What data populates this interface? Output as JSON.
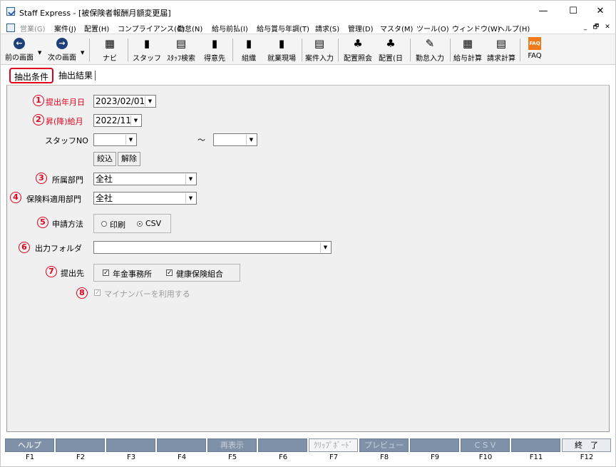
{
  "window": {
    "title": "Staff Express - [被保険者報酬月額変更届]",
    "min_glyph": "—",
    "max_glyph": "☐",
    "close_glyph": "✕"
  },
  "menu": [
    {
      "label": "営業(G)",
      "disabled": true
    },
    {
      "label": "案件(J)",
      "disabled": false
    },
    {
      "label": "配置(H)",
      "disabled": false
    },
    {
      "label": "コンプライアンス(C)",
      "disabled": false
    },
    {
      "label": "勤怠(N)",
      "disabled": false
    },
    {
      "label": "給与前払(I)",
      "disabled": false
    },
    {
      "label": "給与賞与年調(T)",
      "disabled": false
    },
    {
      "label": "請求(S)",
      "disabled": false
    },
    {
      "label": "管理(D)",
      "disabled": false
    },
    {
      "label": "マスタ(M)",
      "disabled": false
    },
    {
      "label": "ツール(O)",
      "disabled": false
    },
    {
      "label": "ウィンドウ(W)",
      "disabled": false
    },
    {
      "label": "ヘルプ(H)",
      "disabled": false
    }
  ],
  "mdi_controls": [
    "_",
    "🗗",
    "✕"
  ],
  "toolbar": [
    {
      "label": "前の画面",
      "icon": "back-arrow-icon",
      "glyph": "←"
    },
    {
      "label": "次の画面",
      "icon": "forward-arrow-icon",
      "glyph": "→"
    },
    {
      "label": "ナビ",
      "icon": "navi-icon",
      "glyph": "▦"
    },
    {
      "label": "スタッフ",
      "icon": "staff-icon",
      "glyph": "▮"
    },
    {
      "label": "ｽﾀｯﾌ検索",
      "icon": "staff-search-icon",
      "glyph": "▤"
    },
    {
      "label": "得意先",
      "icon": "client-icon",
      "glyph": "▮"
    },
    {
      "label": "組織",
      "icon": "organization-icon",
      "glyph": "▮"
    },
    {
      "label": "就業現場",
      "icon": "worksite-icon",
      "glyph": "▮"
    },
    {
      "label": "案件入力",
      "icon": "case-input-icon",
      "glyph": "▤"
    },
    {
      "label": "配置照会",
      "icon": "assignment-inquiry-icon",
      "glyph": "♣"
    },
    {
      "label": "配置(日",
      "icon": "assignment-daily-icon",
      "glyph": "♣"
    },
    {
      "label": "勤怠入力",
      "icon": "attendance-input-icon",
      "glyph": "✎"
    },
    {
      "label": "給与計算",
      "icon": "payroll-calc-icon",
      "glyph": "▦"
    },
    {
      "label": "請求計算",
      "icon": "billing-calc-icon",
      "glyph": "▤"
    },
    {
      "label": "FAQ",
      "icon": "faq-icon",
      "glyph": "FAQ"
    }
  ],
  "tabs": [
    {
      "label": "抽出条件",
      "active": true
    },
    {
      "label": "抽出結果",
      "active": false
    }
  ],
  "form": {
    "submit_date": {
      "num": "1",
      "label": "提出年月日",
      "value": "2023/02/01"
    },
    "pay_raise_month": {
      "num": "2",
      "label": "昇(降)給月",
      "value": "2022/11"
    },
    "staff_no": {
      "label": "スタッフNO",
      "from": "",
      "to": "",
      "tilde": "～"
    },
    "filter_button": "絞込",
    "clear_button": "解除",
    "department": {
      "num": "3",
      "label": "所属部門",
      "value": "全社"
    },
    "insurance_department": {
      "num": "4",
      "label": "保険料適用部門",
      "value": "全社"
    },
    "method": {
      "num": "5",
      "label": "申請方法",
      "options": [
        "印刷",
        "CSV"
      ],
      "selected": "CSV"
    },
    "output_folder": {
      "num": "6",
      "label": "出力フォルダ",
      "value": ""
    },
    "recipients": {
      "num": "7",
      "label": "提出先",
      "options": [
        {
          "label": "年金事務所",
          "checked": true
        },
        {
          "label": "健康保険組合",
          "checked": true
        }
      ]
    },
    "mynumber": {
      "num": "8",
      "label": "マイナンバーを利用する",
      "checked": true,
      "disabled": true
    }
  },
  "fkeys": [
    {
      "label": "ヘルプ",
      "key": "F1",
      "style": "normal"
    },
    {
      "label": "",
      "key": "F2",
      "style": "normal"
    },
    {
      "label": "",
      "key": "F3",
      "style": "normal"
    },
    {
      "label": "",
      "key": "F4",
      "style": "normal"
    },
    {
      "label": "再表示",
      "key": "F5",
      "style": "dis"
    },
    {
      "label": "",
      "key": "F6",
      "style": "normal"
    },
    {
      "label": "ｸﾘｯﾌﾟﾎﾞｰﾄﾞ",
      "key": "F7",
      "style": "clip"
    },
    {
      "label": "プレビュー",
      "key": "F8",
      "style": "dis"
    },
    {
      "label": "",
      "key": "F9",
      "style": "normal"
    },
    {
      "label": "ＣＳＶ",
      "key": "F10",
      "style": "dis"
    },
    {
      "label": "",
      "key": "F11",
      "style": "normal"
    },
    {
      "label": "終　了",
      "key": "F12",
      "style": "light"
    }
  ]
}
